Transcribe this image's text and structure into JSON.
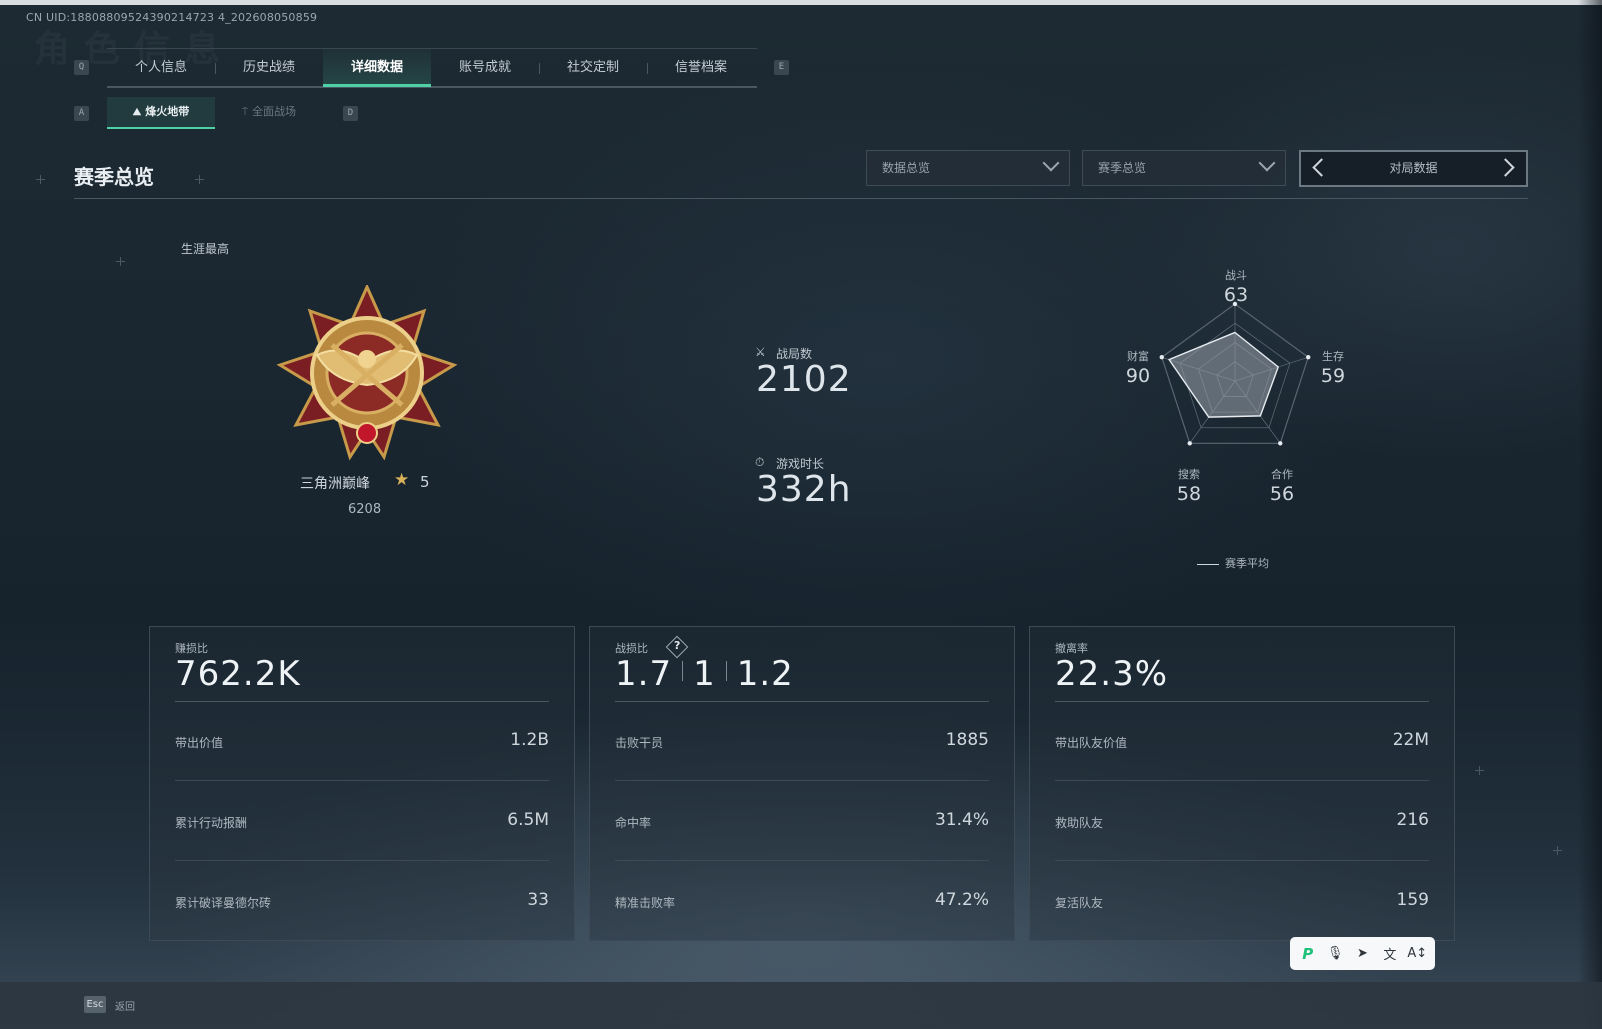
{
  "uid": "CN UID:18808809524390214723 4_202608050859",
  "watermark": "角色信息",
  "hotkeys": {
    "tab_prev": "Q",
    "tab_next": "E",
    "sub_prev": "A",
    "sub_next": "D"
  },
  "tabs": [
    {
      "label": "个人信息",
      "active": false
    },
    {
      "label": "历史战绩",
      "active": false
    },
    {
      "label": "详细数据",
      "active": true
    },
    {
      "label": "账号成就",
      "active": false
    },
    {
      "label": "社交定制",
      "active": false
    },
    {
      "label": "信誉档案",
      "active": false
    }
  ],
  "subtabs": [
    {
      "label": "烽火地带",
      "icon": "mountain-icon",
      "active": true
    },
    {
      "label": "全面战场",
      "icon": "tower-icon",
      "active": false
    }
  ],
  "section": {
    "title": "赛季总览"
  },
  "filters": {
    "dropdown_1": "数据总览",
    "dropdown_2": "赛季总览",
    "pager_label": "对局数据"
  },
  "career": {
    "label": "生涯最高",
    "rank_name": "三角洲巅峰",
    "star_glyph": "★",
    "stars": "5",
    "score": "6208"
  },
  "summary": {
    "matches_label": "战局数",
    "matches_value": "2102",
    "playtime_label": "游戏时长",
    "playtime_value": "332h"
  },
  "radar": {
    "axes": [
      {
        "name": "战斗",
        "value": 63
      },
      {
        "name": "生存",
        "value": 59
      },
      {
        "name": "合作",
        "value": 56
      },
      {
        "name": "搜索",
        "value": 58
      },
      {
        "name": "财富",
        "value": 90
      }
    ],
    "max": 100,
    "legend": "赛季平均",
    "colors": {
      "fill": "#9aa3ab",
      "grid": "#59656f",
      "line": "#e6ebef"
    }
  },
  "panels": [
    {
      "label": "赚损比",
      "value": "762.2K",
      "rows": [
        {
          "label": "带出价值",
          "value": "1.2B"
        },
        {
          "label": "累计行动报酬",
          "value": "6.5M"
        },
        {
          "label": "累计破译曼德尔砖",
          "value": "33"
        }
      ]
    },
    {
      "label": "战损比",
      "value_parts": [
        "1.7",
        "1",
        "1.2"
      ],
      "help": "?",
      "rows": [
        {
          "label": "击败干员",
          "value": "1885"
        },
        {
          "label": "命中率",
          "value": "31.4%"
        },
        {
          "label": "精准击败率",
          "value": "47.2%"
        }
      ]
    },
    {
      "label": "撤离率",
      "value": "22.3%",
      "rows": [
        {
          "label": "带出队友价值",
          "value": "22M"
        },
        {
          "label": "救助队友",
          "value": "216"
        },
        {
          "label": "复活队友",
          "value": "159"
        }
      ]
    }
  ],
  "footer": {
    "esc_key": "Esc",
    "back_label": "返回"
  },
  "float_toolbar": {
    "items": [
      "brand-icon",
      "microphone-icon",
      "send-icon",
      "translate-icon",
      "text-size-icon"
    ],
    "glyphs": [
      "P",
      "🎙",
      "➤",
      "文",
      "A↕"
    ]
  },
  "accent_color": "#4fd1a8"
}
